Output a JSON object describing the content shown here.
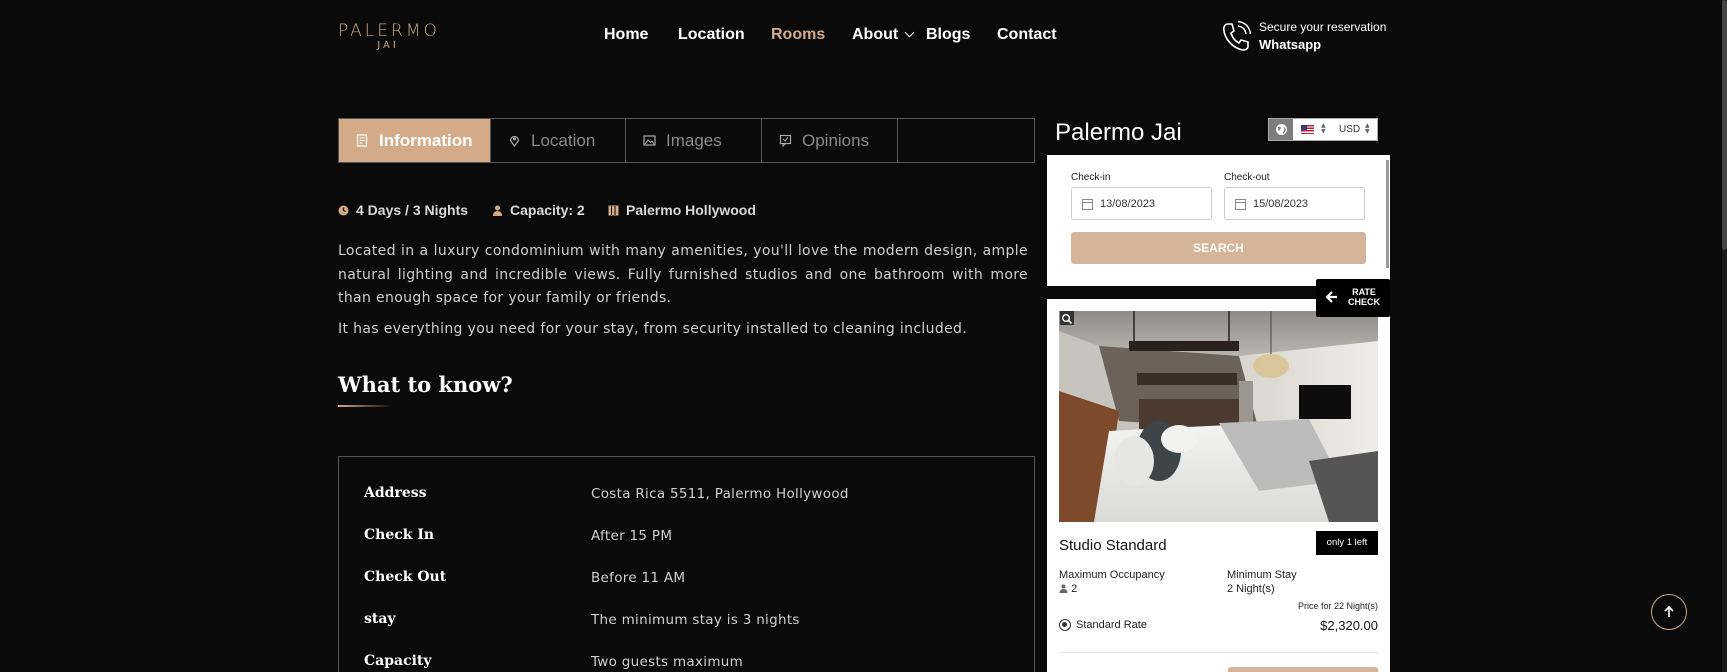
{
  "header": {
    "logo_line1": "PALERMO",
    "logo_line2": "JAI",
    "nav": [
      "Home",
      "Location",
      "Rooms",
      "About",
      "Blogs",
      "Contact"
    ],
    "active_nav": "Rooms",
    "reserve_top": "Secure your reservation",
    "reserve_bottom": "Whatsapp"
  },
  "tabs": [
    {
      "label": "Information",
      "icon": "document-icon",
      "active": true
    },
    {
      "label": "Location",
      "icon": "map-pin-icon",
      "active": false
    },
    {
      "label": "Images",
      "icon": "image-icon",
      "active": false
    },
    {
      "label": "Opinions",
      "icon": "comment-icon",
      "active": false
    }
  ],
  "meta": {
    "duration": "4 Days / 3 Nights",
    "capacity": "Capacity: 2",
    "location": "Palermo Hollywood"
  },
  "description": [
    "Located in a luxury condominium with many amenities, you'll love the modern design, ample natural lighting and incredible views. Fully furnished studios and one bathroom with more than enough space for your family or friends.",
    "It has everything you need for your stay, from security installed to cleaning included."
  ],
  "section_title": "What to know?",
  "details": [
    {
      "key": "Address",
      "value": "Costa Rica 5511, Palermo Hollywood"
    },
    {
      "key": "Check In",
      "value": "After 15 PM"
    },
    {
      "key": "Check Out",
      "value": "Before 11 AM"
    },
    {
      "key": "stay",
      "value": "The minimum stay is 3 nights"
    },
    {
      "key": "Capacity",
      "value": "Two guests maximum"
    }
  ],
  "widget": {
    "title": "Palermo Jai",
    "currency": "USD",
    "checkin_label": "Check-in",
    "checkout_label": "Check-out",
    "checkin_value": "13/08/2023",
    "checkout_value": "15/08/2023",
    "search_label": "SEARCH",
    "rate_check": "RATE\nCHECK",
    "room": {
      "name": "Studio Standard",
      "availability": "only 1 left",
      "max_occupancy_label": "Maximum Occupancy",
      "max_occupancy_value": "2",
      "min_stay_label": "Minimum Stay",
      "min_stay_value": "2 Night(s)",
      "price_note": "Price for 22 Night(s)",
      "rate_name": "Standard Rate",
      "price": "$2,320.00"
    }
  },
  "colors": {
    "background": "#0a0a0a",
    "accent": "#d4ab88",
    "border": "#555555"
  }
}
